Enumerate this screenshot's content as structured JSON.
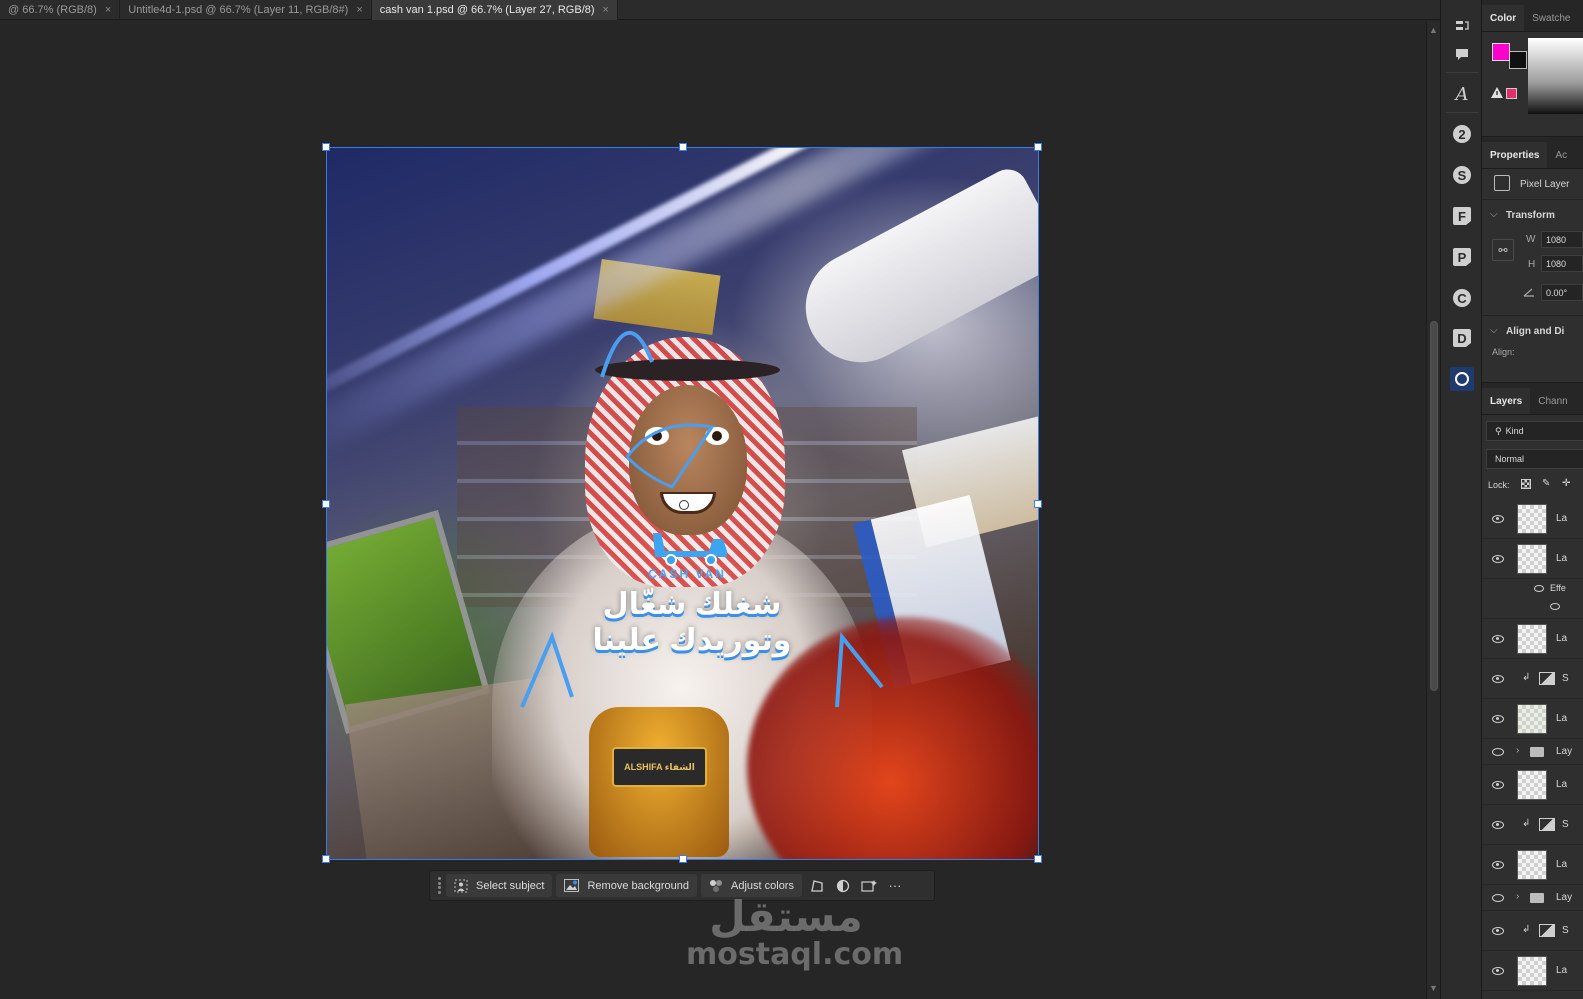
{
  "tabs": [
    {
      "label": "@ 66.7% (RGB/8)",
      "active": false
    },
    {
      "label": "Untitle4d-1.psd @ 66.7% (Layer 11, RGB/8#)",
      "active": false
    },
    {
      "label": "cash van 1.psd @ 66.7% (Layer 27, RGB/8)",
      "active": true
    }
  ],
  "tab_close_glyph": "×",
  "artwork": {
    "logo_text": "CASH VAN",
    "headline_line1": "شغلك شغّال",
    "headline_line2": "وتوريدك علينا",
    "jar_label": "ALSHIFA الشفاء"
  },
  "taskbar": {
    "select_subject": "Select subject",
    "remove_background": "Remove background",
    "adjust_colors": "Adjust colors",
    "more": "···"
  },
  "watermark": {
    "arabic": "مستقل",
    "latin": "mostaql.com"
  },
  "color_panel": {
    "tabs": [
      "Color",
      "Swatche"
    ],
    "foreground": "#ff00cc",
    "background": "#111111",
    "gamut_swatch": "#e0306a"
  },
  "properties_panel": {
    "tabs": [
      "Properties",
      "Ac"
    ],
    "layer_type": "Pixel Layer",
    "transform_label": "Transform",
    "w_label": "W",
    "w_value": "1080",
    "h_label": "H",
    "h_value": "1080",
    "angle_value": "0.00°",
    "align_section": "Align and Di",
    "align_label": "Align:"
  },
  "layers_panel": {
    "tabs": [
      "Layers",
      "Chann"
    ],
    "filter_kind": "Kind",
    "blend_mode": "Normal",
    "lock_label": "Lock:",
    "layers": [
      {
        "name": "La",
        "kind": "pixel"
      },
      {
        "name": "La",
        "kind": "pixel"
      },
      {
        "name": "Effe",
        "kind": "effect"
      },
      {
        "name": "La",
        "kind": "pixel"
      },
      {
        "name": "S",
        "kind": "adjustment"
      },
      {
        "name": "La",
        "kind": "pixel"
      },
      {
        "name": "Lay",
        "kind": "group"
      },
      {
        "name": "La",
        "kind": "pixel"
      },
      {
        "name": "S",
        "kind": "adjustment"
      },
      {
        "name": "La",
        "kind": "pixel"
      },
      {
        "name": "Lay",
        "kind": "group"
      },
      {
        "name": "S",
        "kind": "adjustment"
      },
      {
        "name": "La",
        "kind": "pixel"
      }
    ]
  },
  "toolstrip_icons": [
    "history-icon",
    "comment-icon",
    "glyphs-icon",
    "plugin-2-icon",
    "plugin-s-icon",
    "plugin-f-icon",
    "plugin-p-icon",
    "plugin-c-icon",
    "plugin-d-icon",
    "plugin-circle-icon"
  ]
}
